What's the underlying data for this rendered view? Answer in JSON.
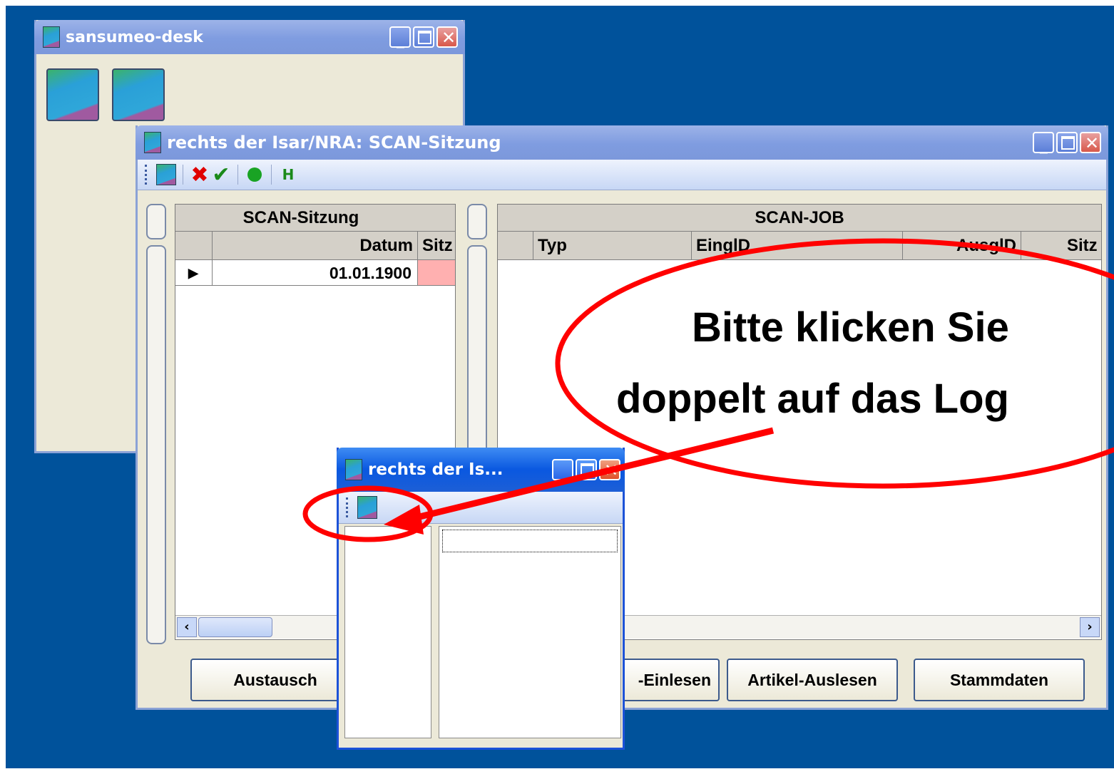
{
  "desk_window": {
    "title": "sansumeo-desk"
  },
  "main_window": {
    "title": "rechts der Isar/NRA: SCAN-Sitzung",
    "toolbar": {
      "h_label": "H"
    },
    "sitzung_grid": {
      "header": "SCAN-Sitzung",
      "columns": [
        "Datum",
        "Sitz"
      ],
      "rows": [
        {
          "datum": "01.01.1900"
        }
      ]
    },
    "job_grid": {
      "header": "SCAN-JOB",
      "columns": [
        "Typ",
        "EinglD",
        "AusglD",
        "Sitz"
      ]
    },
    "buttons": {
      "austausch": "Austausch",
      "einlesen": "-Einlesen",
      "artikel_auslesen": "Artikel-Auslesen",
      "stammdaten": "Stammdaten"
    }
  },
  "small_window": {
    "title": "rechts der Is..."
  },
  "annotation": {
    "line1": "Bitte klicken Sie",
    "line2": "doppelt auf das Log"
  },
  "colors": {
    "desktop": "#00529b",
    "annotation_red": "#ff0000",
    "row_highlight": "#ffb0b0"
  }
}
